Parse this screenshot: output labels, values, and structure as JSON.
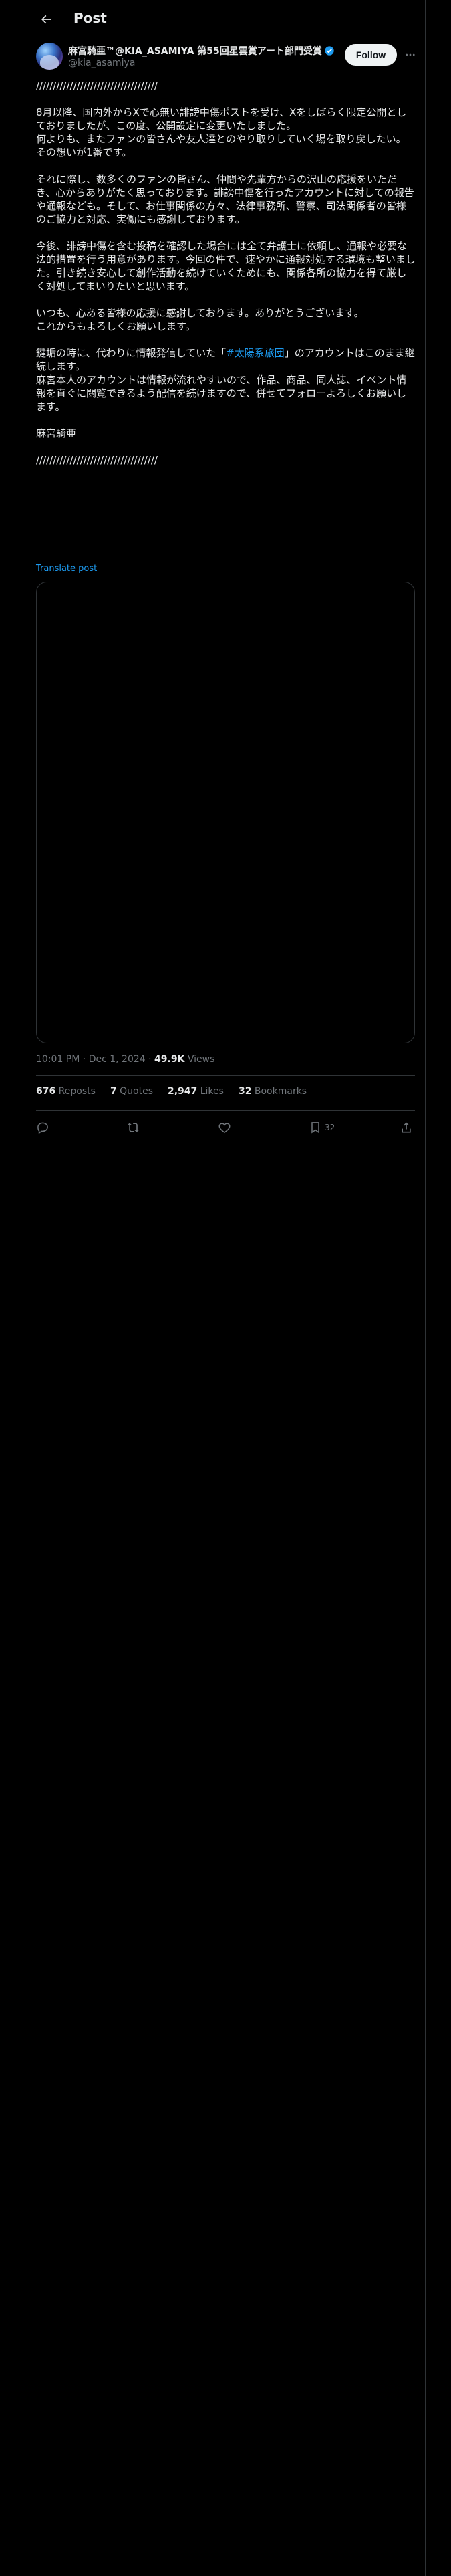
{
  "header": {
    "title": "Post",
    "back_icon": "back-arrow-icon"
  },
  "author": {
    "display_name": "麻宮騎亜™@KIA_ASAMIYA 第55回星雲賞アート部門受賞",
    "handle": "@kia_asamiya",
    "verified_icon": "verified-badge-icon",
    "follow_label": "Follow",
    "more_icon": "more-icon"
  },
  "post": {
    "p1": "////////////////////////////////////",
    "p2": "8月以降、国内外からXで心無い誹謗中傷ポストを受け、Xをしばらく限定公開としておりましたが、この度、公開設定に変更いたしました。\n何よりも、またファンの皆さんや友人達とのやり取りしていく場を取り戻したい。その想いが1番です。",
    "p3": "それに際し、数多くのファンの皆さん、仲間や先輩方からの沢山の応援をいただき、心からありがたく思っております。誹謗中傷を行ったアカウントに対しての報告や通報なども。そして、お仕事関係の方々、法律事務所、警察、司法関係者の皆様のご協力と対応、実働にも感謝しております。",
    "p4": "今後、誹謗中傷を含む投稿を確認した場合には全て弁護士に依頼し、通報や必要な法的措置を行う用意があります。今回の件で、速やかに通報対処する環境も整いました。引き続き安心して創作活動を続けていくためにも、関係各所の協力を得て厳しく対処してまいりたいと思います。",
    "p5": "いつも、心ある皆様の応援に感謝しております。ありがとうございます。\nこれからもよろしくお願いします。",
    "p6_before": "鍵垢の時に、代わりに情報発信していた「",
    "p6_hashtag": "#太陽系旅団",
    "p6_after": "」のアカウントはこのまま継続します。\n麻宮本人のアカウントは情報が流れやすいので、作品、商品、同人誌、イベント情報を直ぐに閲覧できるよう配信を続けますので、併せてフォローよろしくお願いします。",
    "p7": "麻宮騎亜",
    "p8": "////////////////////////////////////",
    "translate_label": "Translate post"
  },
  "meta": {
    "time": "10:01 PM",
    "sep1": " · ",
    "date": "Dec 1, 2024",
    "sep2": " · ",
    "views_count": "49.9K",
    "views_label": " Views"
  },
  "stats": {
    "reposts_count": "676",
    "reposts_label": " Reposts",
    "quotes_count": "7",
    "quotes_label": " Quotes",
    "likes_count": "2,947",
    "likes_label": " Likes",
    "bookmarks_count": "32",
    "bookmarks_label": " Bookmarks"
  },
  "actions": {
    "reply_icon": "reply-icon",
    "repost_icon": "repost-icon",
    "like_icon": "heart-icon",
    "bookmark_icon": "bookmark-icon",
    "bookmark_count": "32",
    "share_icon": "share-icon"
  },
  "colors": {
    "accent": "#1d9bf0",
    "background": "#000000",
    "text": "#e7e9ea",
    "muted": "#71767b",
    "border": "#2f3336"
  }
}
